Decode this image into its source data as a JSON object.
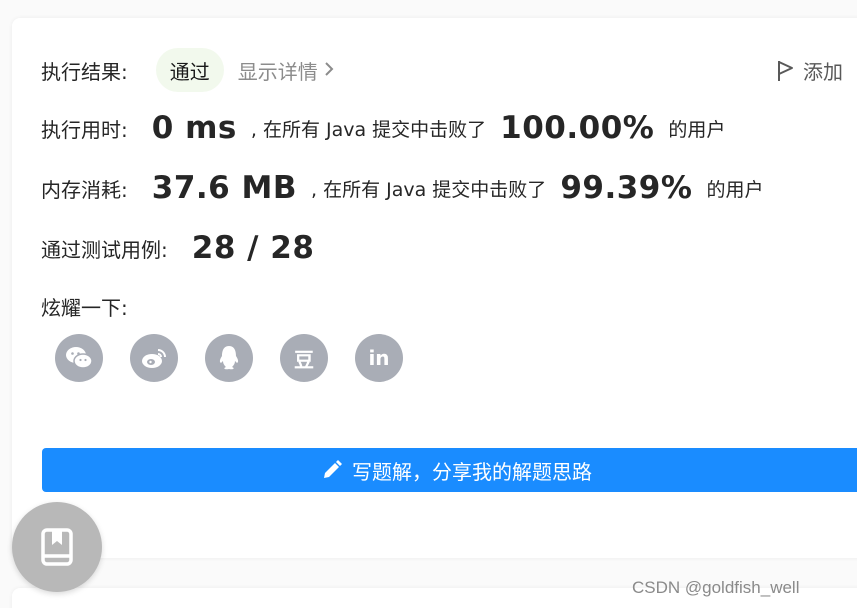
{
  "result": {
    "label": "执行结果:",
    "status": "通过",
    "details_link": "显示详情",
    "add_note": "添加"
  },
  "runtime": {
    "label": "执行用时:",
    "value": "0 ms",
    "beat_text": ", 在所有 Java 提交中击败了",
    "percent": "100.00%",
    "suffix": "的用户"
  },
  "memory": {
    "label": "内存消耗:",
    "value": "37.6 MB",
    "beat_text": ", 在所有 Java 提交中击败了",
    "percent": "99.39%",
    "suffix": "的用户"
  },
  "testcases": {
    "label": "通过测试用例:",
    "value": "28 / 28"
  },
  "share": {
    "label": "炫耀一下:",
    "buttons": [
      {
        "icon": "wechat-icon"
      },
      {
        "icon": "weibo-icon"
      },
      {
        "icon": "qq-icon"
      },
      {
        "icon": "douban-icon",
        "text": "豆"
      },
      {
        "icon": "linkedin-icon",
        "text": "in"
      }
    ]
  },
  "write_solution": {
    "label": "写题解，分享我的解题思路"
  },
  "watermark": "CSDN @goldfish_well",
  "colors": {
    "primary": "#1a8cff",
    "pass_bg": "#f2f9ed",
    "share_icon_bg": "#a9adb6",
    "float_button_bg": "#b8b8b8"
  }
}
